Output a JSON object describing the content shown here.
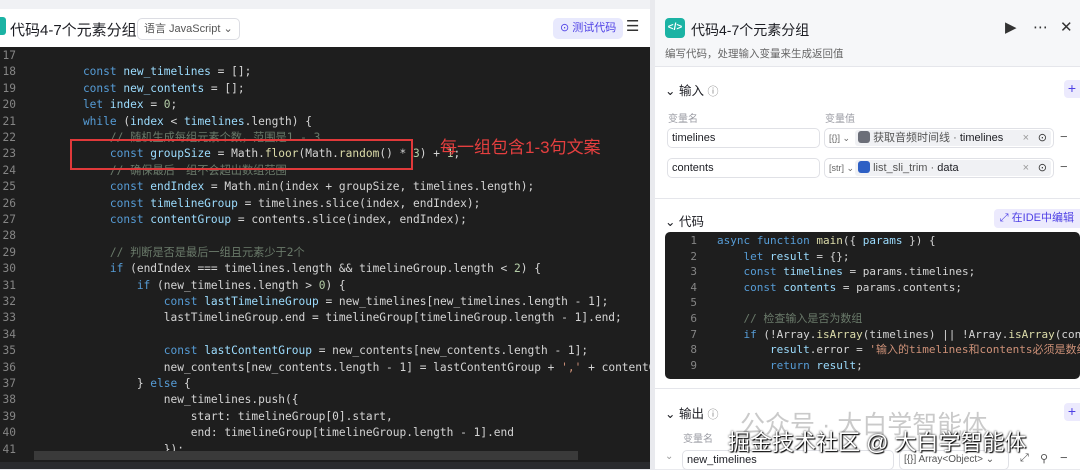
{
  "editor": {
    "title": "代码4-7个元素分组",
    "language": "语言 JavaScript",
    "test_button": "测试代码",
    "menu_icon": "collapse-menu-icon",
    "annotation": "每一组包含1-3句文案",
    "lines": [
      {
        "n": "17",
        "t": []
      },
      {
        "n": "18",
        "t": [
          [
            "k",
            "    const "
          ],
          [
            "v",
            "new_timelines"
          ],
          [
            "p",
            " = [];"
          ]
        ]
      },
      {
        "n": "19",
        "t": [
          [
            "k",
            "    const "
          ],
          [
            "v",
            "new_contents"
          ],
          [
            "p",
            " = [];"
          ]
        ]
      },
      {
        "n": "20",
        "t": [
          [
            "k",
            "    let "
          ],
          [
            "v",
            "index"
          ],
          [
            "p",
            " = "
          ],
          [
            "m",
            "0"
          ],
          [
            "p",
            ";"
          ]
        ]
      },
      {
        "n": "21",
        "t": [
          [
            "k",
            "    while "
          ],
          [
            "p",
            "("
          ],
          [
            "v",
            "index"
          ],
          [
            "p",
            " < "
          ],
          [
            "v",
            "timelines"
          ],
          [
            "p",
            ".length) {"
          ]
        ]
      },
      {
        "n": "22",
        "t": [
          [
            "c",
            "        // 随机生成每组元素个数，范围是1 - 3"
          ]
        ]
      },
      {
        "n": "23",
        "t": [
          [
            "k",
            "        const "
          ],
          [
            "v",
            "groupSize"
          ],
          [
            "p",
            " = Math."
          ],
          [
            "f",
            "floor"
          ],
          [
            "p",
            "(Math."
          ],
          [
            "f",
            "random"
          ],
          [
            "p",
            "() * "
          ],
          [
            "m",
            "3"
          ],
          [
            "p",
            ") + "
          ],
          [
            "m",
            "1"
          ],
          [
            "p",
            ";"
          ]
        ]
      },
      {
        "n": "24",
        "t": [
          [
            "c",
            "        // 确保最后一组不会超出数组范围"
          ]
        ]
      },
      {
        "n": "25",
        "t": [
          [
            "k",
            "        const "
          ],
          [
            "v",
            "endIndex"
          ],
          [
            "p",
            " = Math.min(index + groupSize, timelines.length);"
          ]
        ]
      },
      {
        "n": "26",
        "t": [
          [
            "k",
            "        const "
          ],
          [
            "v",
            "timelineGroup"
          ],
          [
            "p",
            " = timelines.slice(index, endIndex);"
          ]
        ]
      },
      {
        "n": "27",
        "t": [
          [
            "k",
            "        const "
          ],
          [
            "v",
            "contentGroup"
          ],
          [
            "p",
            " = contents.slice(index, endIndex);"
          ]
        ]
      },
      {
        "n": "28",
        "t": []
      },
      {
        "n": "29",
        "t": [
          [
            "c",
            "        // 判断是否是最后一组且元素少于2个"
          ]
        ]
      },
      {
        "n": "30",
        "t": [
          [
            "k",
            "        if "
          ],
          [
            "p",
            "(endIndex === timelines.length && timelineGroup.length < "
          ],
          [
            "m",
            "2"
          ],
          [
            "p",
            ") {"
          ]
        ]
      },
      {
        "n": "31",
        "t": [
          [
            "k",
            "            if "
          ],
          [
            "p",
            "(new_timelines.length > "
          ],
          [
            "m",
            "0"
          ],
          [
            "p",
            ") {"
          ]
        ]
      },
      {
        "n": "32",
        "t": [
          [
            "k",
            "                const "
          ],
          [
            "v",
            "lastTimelineGroup"
          ],
          [
            "p",
            " = new_timelines[new_timelines.length - 1];"
          ]
        ]
      },
      {
        "n": "33",
        "t": [
          [
            "p",
            "                lastTimelineGroup.end = timelineGroup[timelineGroup.length - 1].end;"
          ]
        ]
      },
      {
        "n": "34",
        "t": []
      },
      {
        "n": "35",
        "t": [
          [
            "k",
            "                const "
          ],
          [
            "v",
            "lastContentGroup"
          ],
          [
            "p",
            " = new_contents[new_contents.length - 1];"
          ]
        ]
      },
      {
        "n": "36",
        "t": [
          [
            "p",
            "                new_contents[new_contents.length - 1] = lastContentGroup + "
          ],
          [
            "s",
            "','"
          ],
          [
            "p",
            " + contentGroup.join"
          ]
        ]
      },
      {
        "n": "37",
        "t": [
          [
            "p",
            "            } "
          ],
          [
            "k",
            "else"
          ],
          [
            "p",
            " {"
          ]
        ]
      },
      {
        "n": "38",
        "t": [
          [
            "p",
            "                new_timelines.push({"
          ]
        ]
      },
      {
        "n": "39",
        "t": [
          [
            "p",
            "                    start: timelineGroup[0].start,"
          ]
        ]
      },
      {
        "n": "40",
        "t": [
          [
            "p",
            "                    end: timelineGroup[timelineGroup.length - 1].end"
          ]
        ]
      },
      {
        "n": "41",
        "t": [
          [
            "p",
            "                });"
          ]
        ]
      }
    ]
  },
  "panel": {
    "title": "代码4-7个元素分组",
    "description": "编写代码，处理输入变量来生成返回值",
    "input_section": "输入",
    "col_name": "变量名",
    "col_value": "变量值",
    "inputs": [
      {
        "name": "timelines",
        "type": "[{}]",
        "source": "获取音频时间线",
        "field": "timelines"
      },
      {
        "name": "contents",
        "type": "[str]",
        "source": "list_sli_trim",
        "field": "data"
      }
    ],
    "code_section": "代码",
    "ide_button": "在IDE中编辑",
    "code": [
      {
        "n": "1",
        "t": [
          [
            "k",
            "async function "
          ],
          [
            "f",
            "main"
          ],
          [
            "p",
            "({ "
          ],
          [
            "v",
            "params"
          ],
          [
            "p",
            " }) {"
          ]
        ]
      },
      {
        "n": "2",
        "t": [
          [
            "k",
            "    let "
          ],
          [
            "v",
            "result"
          ],
          [
            "p",
            " = {};"
          ]
        ]
      },
      {
        "n": "3",
        "t": [
          [
            "k",
            "    const "
          ],
          [
            "v",
            "timelines"
          ],
          [
            "p",
            " = params.timelines;"
          ]
        ]
      },
      {
        "n": "4",
        "t": [
          [
            "k",
            "    const "
          ],
          [
            "v",
            "contents"
          ],
          [
            "p",
            " = params.contents;"
          ]
        ]
      },
      {
        "n": "5",
        "t": []
      },
      {
        "n": "6",
        "t": [
          [
            "c",
            "    // 检查输入是否为数组"
          ]
        ]
      },
      {
        "n": "7",
        "t": [
          [
            "k",
            "    if "
          ],
          [
            "p",
            "(!Array."
          ],
          [
            "f",
            "isArray"
          ],
          [
            "p",
            "(timelines) || !Array."
          ],
          [
            "f",
            "isArray"
          ],
          [
            "p",
            "(conten"
          ]
        ]
      },
      {
        "n": "8",
        "t": [
          [
            "v",
            "        result"
          ],
          [
            "p",
            ".error = "
          ],
          [
            "s",
            "'输入的timelines和contents必须是数组"
          ]
        ]
      },
      {
        "n": "9",
        "t": [
          [
            "k",
            "        return "
          ],
          [
            "v",
            "result"
          ],
          [
            "p",
            ";"
          ]
        ]
      }
    ],
    "output_section": "输出",
    "output_col_name": "变量名",
    "outputs": [
      {
        "name": "new_timelines",
        "type": "Array<Object>"
      }
    ]
  },
  "watermark": {
    "line1": "公众号 · 大白学智能体",
    "line2": "掘金技术社区 @ 大白学智能体"
  }
}
